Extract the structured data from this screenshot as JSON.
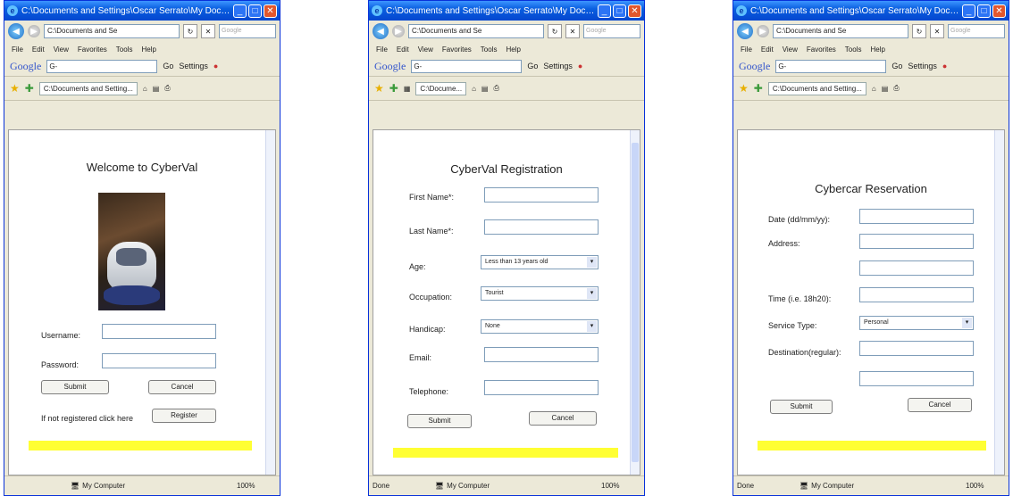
{
  "windows": [
    {
      "title": "C:\\Documents and Settings\\Oscar Serrato\\My Docu...",
      "address": "C:\\Documents and Se",
      "search_placeholder": "Google",
      "menu": [
        "File",
        "Edit",
        "View",
        "Favorites",
        "Tools",
        "Help"
      ],
      "google": {
        "logo": "Google",
        "box": "G-",
        "go": "Go",
        "settings": "Settings"
      },
      "tab": "C:\\Documents and Setting...",
      "page_title": "Welcome to CyberVal",
      "fields": [
        "Username:",
        "Password:"
      ],
      "buttons": {
        "submit": "Submit",
        "cancel": "Cancel",
        "register": "Register"
      },
      "register_text": "If not registered click here",
      "status": {
        "left": "",
        "zone": "My Computer",
        "zoom": "100%"
      }
    },
    {
      "title": "C:\\Documents and Settings\\Oscar Serrato\\My Docu...",
      "address": "C:\\Documents and Se",
      "search_placeholder": "Google",
      "menu": [
        "File",
        "Edit",
        "View",
        "Favorites",
        "Tools",
        "Help"
      ],
      "google": {
        "logo": "Google",
        "box": "G-",
        "go": "Go",
        "settings": "Settings"
      },
      "tab": "C:\\Docume...",
      "page_title": "CyberVal Registration",
      "fields": [
        "First Name*:",
        "Last Name*:",
        "Age:",
        "Occupation:",
        "Handicap:",
        "Email:",
        "Telephone:"
      ],
      "selects": {
        "age": "Less than 13 years old",
        "occupation": "Tourist",
        "handicap": "None"
      },
      "buttons": {
        "submit": "Submit",
        "cancel": "Cancel"
      },
      "status": {
        "left": "Done",
        "zone": "My Computer",
        "zoom": "100%"
      }
    },
    {
      "title": "C:\\Documents and Settings\\Oscar Serrato\\My Docu...",
      "address": "C:\\Documents and Se",
      "search_placeholder": "Google",
      "menu": [
        "File",
        "Edit",
        "View",
        "Favorites",
        "Tools",
        "Help"
      ],
      "google": {
        "logo": "Google",
        "box": "G-",
        "go": "Go",
        "settings": "Settings"
      },
      "tab": "C:\\Documents and Setting...",
      "page_title": "Cybercar Reservation",
      "fields": [
        "Date (dd/mm/yy):",
        "Address:",
        "Time (i.e. 18h20):",
        "Service Type:",
        "Destination(regular):"
      ],
      "selects": {
        "service": "Personal"
      },
      "buttons": {
        "submit": "Submit",
        "cancel": "Cancel"
      },
      "status": {
        "left": "Done",
        "zone": "My Computer",
        "zoom": "100%"
      }
    }
  ]
}
